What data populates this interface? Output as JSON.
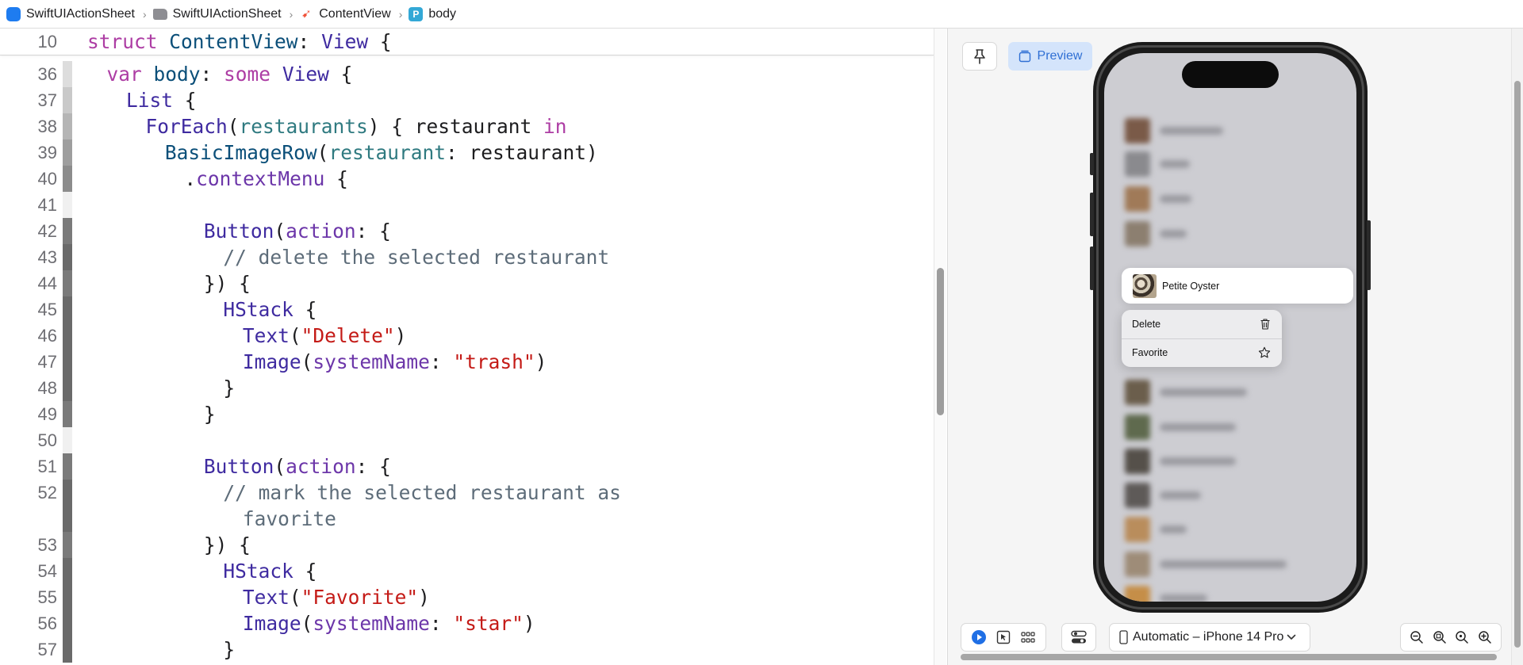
{
  "breadcrumb": [
    {
      "label": "SwiftUIActionSheet",
      "icon": "xcode-app-icon",
      "color": "#1e7cf0"
    },
    {
      "label": "SwiftUIActionSheet",
      "icon": "folder-icon",
      "color": "#8e8e93"
    },
    {
      "label": "ContentView",
      "icon": "swift-icon",
      "color": "#f05138"
    },
    {
      "label": "body",
      "icon": "property-p-icon",
      "color": "#33a8d6"
    }
  ],
  "editor": {
    "sticky": {
      "number": "10",
      "parts": [
        [
          "struct",
          "kw"
        ],
        [
          " ",
          "pl"
        ],
        [
          "ContentView",
          "ti"
        ],
        [
          ": ",
          "pl"
        ],
        [
          "View",
          "ty"
        ],
        [
          " {",
          "pl"
        ]
      ]
    },
    "lines": [
      {
        "number": "36",
        "indent": 4,
        "parts": [
          [
            "var",
            "kw"
          ],
          [
            " ",
            "pl"
          ],
          [
            "body",
            "ti"
          ],
          [
            ": ",
            "pl"
          ],
          [
            "some",
            "kw"
          ],
          [
            " ",
            "pl"
          ],
          [
            "View",
            "ty"
          ],
          [
            " {",
            "pl"
          ]
        ]
      },
      {
        "number": "37",
        "indent": 8,
        "parts": [
          [
            "List",
            "ty"
          ],
          [
            " {",
            "pl"
          ]
        ]
      },
      {
        "number": "38",
        "indent": 12,
        "parts": [
          [
            "ForEach",
            "ty"
          ],
          [
            "(",
            "pl"
          ],
          [
            "restaurants",
            "prm"
          ],
          [
            ") { restaurant ",
            "pl"
          ],
          [
            "in",
            "kw"
          ]
        ]
      },
      {
        "number": "39",
        "indent": 16,
        "parts": [
          [
            "BasicImageRow",
            "ti"
          ],
          [
            "(",
            "pl"
          ],
          [
            "restaurant",
            "prm"
          ],
          [
            ": restaurant)",
            "pl"
          ]
        ]
      },
      {
        "number": "40",
        "indent": 20,
        "parts": [
          [
            ".",
            "pl"
          ],
          [
            "contextMenu",
            "mth"
          ],
          [
            " {",
            "pl"
          ]
        ]
      },
      {
        "number": "41",
        "indent": 0,
        "parts": []
      },
      {
        "number": "42",
        "indent": 24,
        "parts": [
          [
            "Button",
            "ty"
          ],
          [
            "(",
            "pl"
          ],
          [
            "action",
            "mth"
          ],
          [
            ": {",
            "pl"
          ]
        ]
      },
      {
        "number": "43",
        "indent": 28,
        "parts": [
          [
            "// delete the selected restaurant",
            "cmt"
          ]
        ]
      },
      {
        "number": "44",
        "indent": 24,
        "parts": [
          [
            "}) {",
            "pl"
          ]
        ]
      },
      {
        "number": "45",
        "indent": 28,
        "parts": [
          [
            "HStack",
            "ty"
          ],
          [
            " {",
            "pl"
          ]
        ]
      },
      {
        "number": "46",
        "indent": 32,
        "parts": [
          [
            "Text",
            "ty"
          ],
          [
            "(",
            "pl"
          ],
          [
            "\"Delete\"",
            "str"
          ],
          [
            ")",
            "pl"
          ]
        ]
      },
      {
        "number": "47",
        "indent": 32,
        "parts": [
          [
            "Image",
            "ty"
          ],
          [
            "(",
            "pl"
          ],
          [
            "systemName",
            "mth"
          ],
          [
            ": ",
            "pl"
          ],
          [
            "\"trash\"",
            "str"
          ],
          [
            ")",
            "pl"
          ]
        ]
      },
      {
        "number": "48",
        "indent": 28,
        "parts": [
          [
            "}",
            "pl"
          ]
        ]
      },
      {
        "number": "49",
        "indent": 24,
        "parts": [
          [
            "}",
            "pl"
          ]
        ]
      },
      {
        "number": "50",
        "indent": 0,
        "parts": []
      },
      {
        "number": "51",
        "indent": 24,
        "parts": [
          [
            "Button",
            "ty"
          ],
          [
            "(",
            "pl"
          ],
          [
            "action",
            "mth"
          ],
          [
            ": {",
            "pl"
          ]
        ]
      },
      {
        "number": "52",
        "indent": 28,
        "parts": [
          [
            "// mark the selected restaurant as",
            "cmt"
          ]
        ]
      },
      {
        "number": "",
        "indent": 32,
        "parts": [
          [
            "favorite",
            "cmt"
          ]
        ]
      },
      {
        "number": "53",
        "indent": 24,
        "parts": [
          [
            "}) {",
            "pl"
          ]
        ]
      },
      {
        "number": "54",
        "indent": 28,
        "parts": [
          [
            "HStack",
            "ty"
          ],
          [
            " {",
            "pl"
          ]
        ]
      },
      {
        "number": "55",
        "indent": 32,
        "parts": [
          [
            "Text",
            "ty"
          ],
          [
            "(",
            "pl"
          ],
          [
            "\"Favorite\"",
            "str"
          ],
          [
            ")",
            "pl"
          ]
        ]
      },
      {
        "number": "56",
        "indent": 32,
        "parts": [
          [
            "Image",
            "ty"
          ],
          [
            "(",
            "pl"
          ],
          [
            "systemName",
            "mth"
          ],
          [
            ": ",
            "pl"
          ],
          [
            "\"star\"",
            "str"
          ],
          [
            ")",
            "pl"
          ]
        ]
      },
      {
        "number": "57",
        "indent": 28,
        "parts": [
          [
            "}",
            "pl"
          ]
        ]
      }
    ]
  },
  "preview": {
    "preview_label": "Preview",
    "focused_row": "Petite Oyster",
    "context_menu": [
      {
        "label": "Delete",
        "icon": "trash-icon"
      },
      {
        "label": "Favorite",
        "icon": "star-icon"
      }
    ],
    "device_label": "Automatic – iPhone 14 Pro"
  },
  "colors": {
    "keyword": "#ad3da4",
    "type": "#3f2ba0",
    "string": "#c41a16",
    "comment": "#5d6c79",
    "accent": "#2f6fd4"
  }
}
